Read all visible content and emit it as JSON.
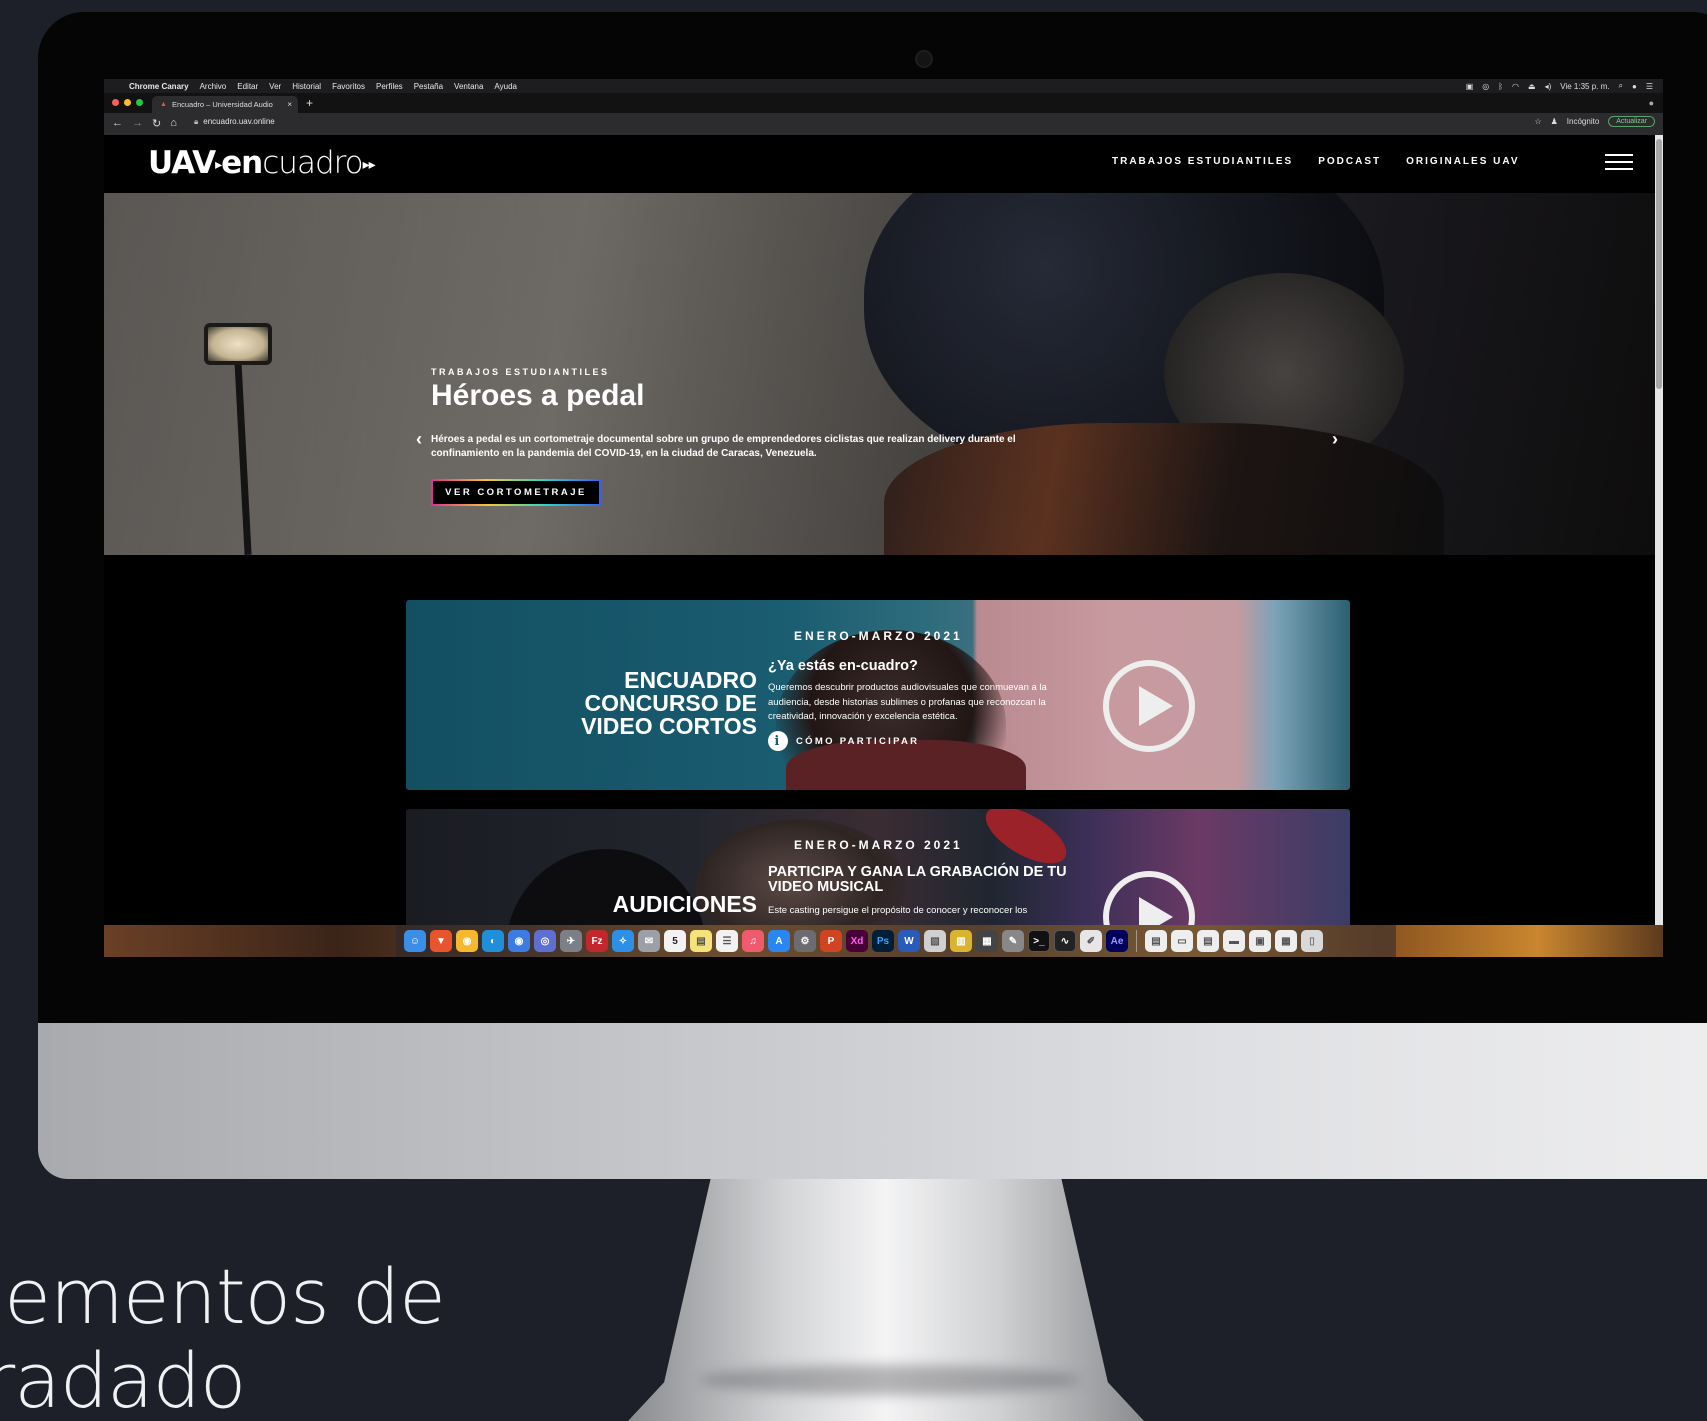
{
  "menubar": {
    "apple": "",
    "app": "Chrome Canary",
    "menus": [
      "Archivo",
      "Editar",
      "Ver",
      "Historial",
      "Favoritos",
      "Perfiles",
      "Pestaña",
      "Ventana",
      "Ayuda"
    ],
    "clock": "Vie 1:35 p. m."
  },
  "browser": {
    "tab_title": "Encuadro – Universidad Audio",
    "tab_close": "×",
    "new_tab": "+",
    "url": "encuadro.uav.online",
    "incognito": "Incógnito",
    "update": "Actualizar"
  },
  "site": {
    "logo_uav": "UAV",
    "logo_en": "en",
    "logo_rest": "cuadro",
    "nav": [
      "TRABAJOS ESTUDIANTILES",
      "PODCAST",
      "ORIGINALES UAV"
    ]
  },
  "hero": {
    "eyebrow": "TRABAJOS ESTUDIANTILES",
    "title": "Héroes a pedal",
    "description": "Héroes a pedal es un cortometraje documental sobre un grupo de emprendedores ciclistas que realizan delivery durante el confinamiento en la pandemia del COVID-19, en la ciudad de Caracas, Venezuela.",
    "button": "VER CORTOMETRAJE",
    "prev": "‹",
    "next": "›"
  },
  "banner1": {
    "eyebrow": "ENERO-MARZO 2021",
    "title_lines": [
      "ENCUADRO",
      "CONCURSO DE",
      "VIDEO CORTOS"
    ],
    "question": "¿Ya estás en-cuadro?",
    "description": "Queremos descubrir productos audiovisuales que conmuevan a la audiencia, desde historias sublimes o profanas que reconozcan la creatividad, innovación y excelencia estética.",
    "info_icon": "i",
    "info_label": "CÓMO PARTICIPAR"
  },
  "banner2": {
    "eyebrow": "ENERO-MARZO 2021",
    "title": "AUDICIONES",
    "subtitle": "PARTICIPA Y GANA LA GRABACIÓN DE TU VIDEO MUSICAL",
    "description": "Este casting persigue el propósito de conocer y reconocer los"
  },
  "dock": {
    "ps": "Ps",
    "xd": "Xd",
    "ae": "Ae",
    "fz": "Fz",
    "cal": "5"
  },
  "caption": {
    "line1": "lementos de",
    "line2": "radado"
  },
  "colors": {
    "background": "#1d2029",
    "banner1_teal": "#1a5c70",
    "update_green": "#5aa36a"
  }
}
